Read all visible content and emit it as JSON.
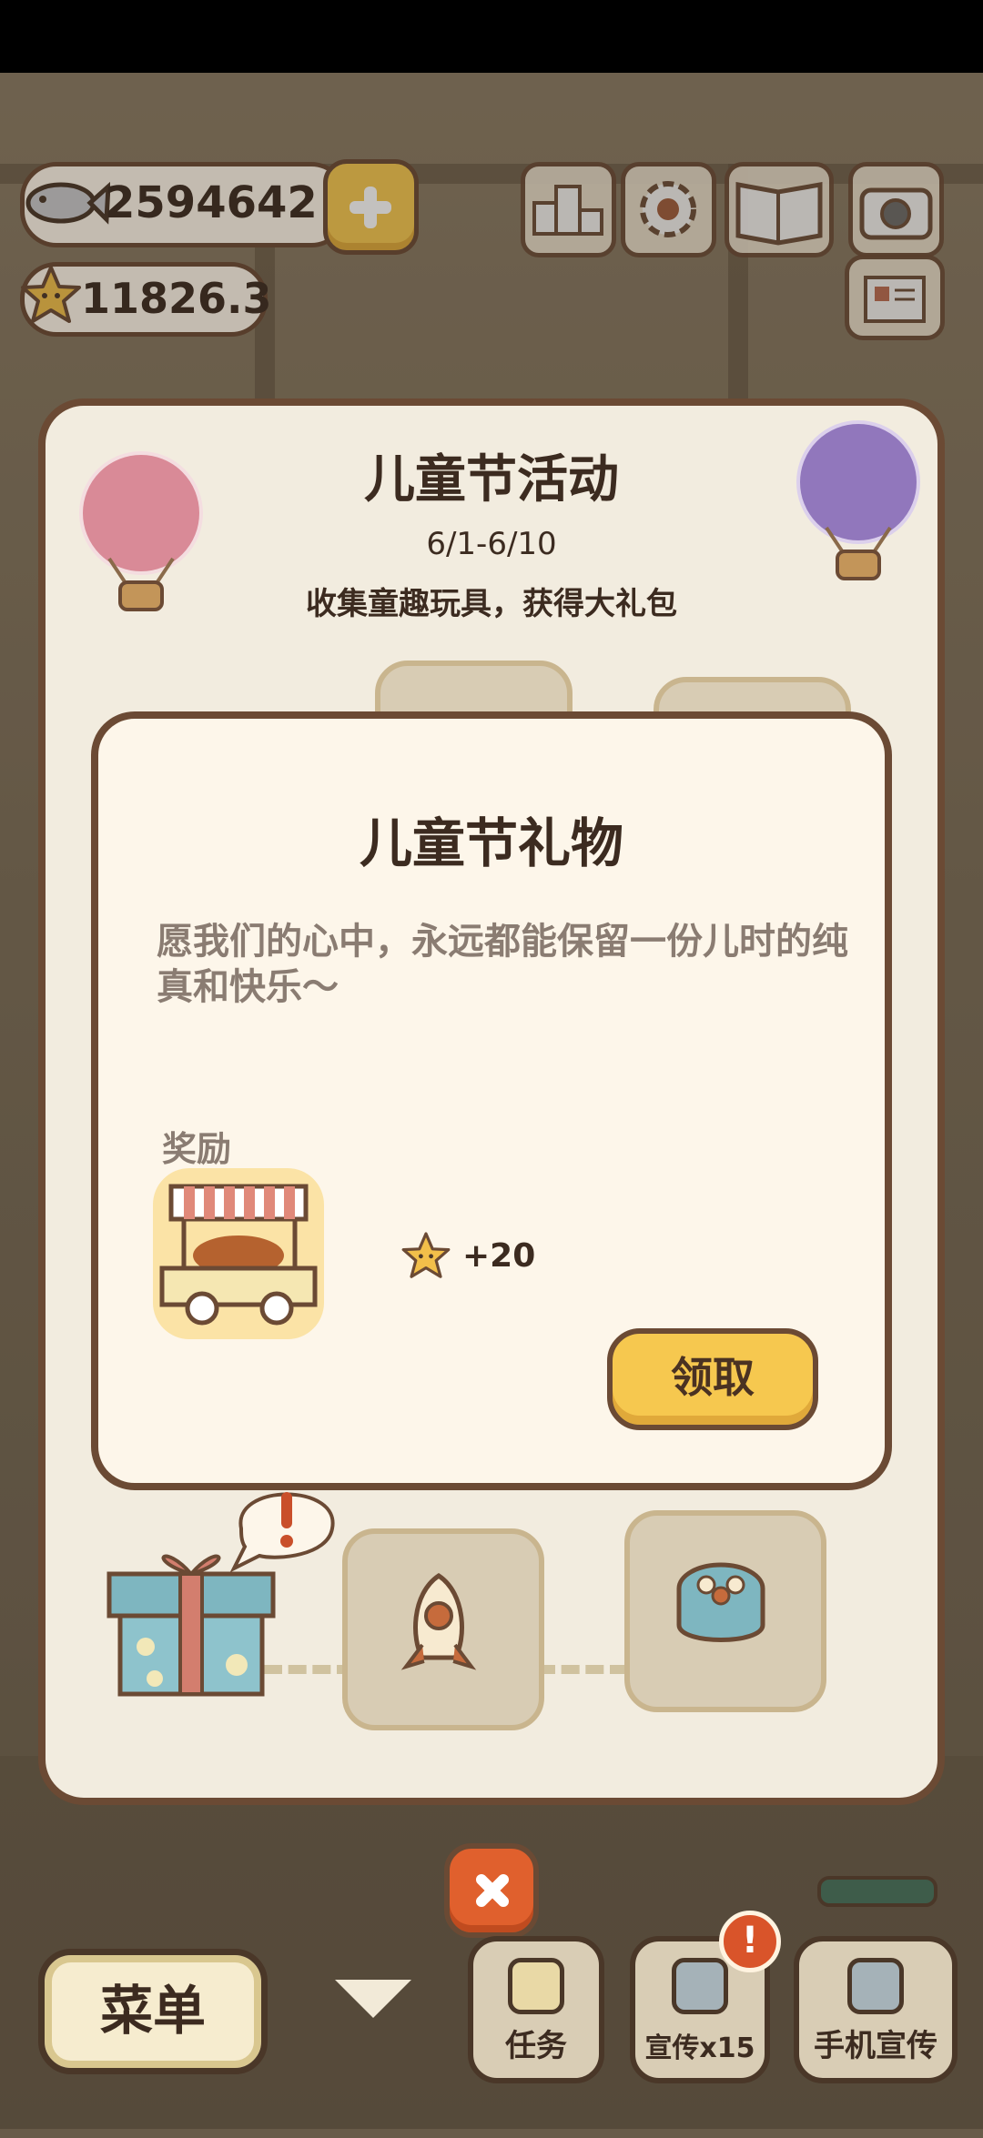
{
  "currency": {
    "fish_amount": "2594642",
    "star_amount": "11826.3"
  },
  "event": {
    "title": "儿童节活动",
    "dates": "6/1-6/10",
    "description": "收集童趣玩具，获得大礼包"
  },
  "dialog": {
    "title": "儿童节礼物",
    "message": "愿我们的心中，永远都能保留一份儿时的纯真和快乐～",
    "reward_label": "奖励",
    "reward_star_amount": "+20",
    "claim_label": "领取"
  },
  "bottom_bar": {
    "menu_label": "菜单",
    "tasks_label": "任务",
    "promote_label": "宣传x15",
    "phone_promote_label": "手机宣传",
    "notification_badge": "!"
  },
  "colors": {
    "accent_yellow": "#f6c84f",
    "border_brown": "#6b4a34",
    "close_orange": "#e0602d"
  },
  "icons": [
    "fish-icon",
    "plus-icon",
    "star-icon",
    "ranking-icon",
    "settings-gear-icon",
    "book-icon",
    "camera-icon",
    "notice-board-icon",
    "balloon-icon",
    "gift-box-icon",
    "rocket-toy-icon",
    "cake-toy-icon",
    "food-cart-icon",
    "close-icon",
    "checklist-icon",
    "flyer-icon",
    "phone-icon",
    "down-arrow-icon"
  ]
}
